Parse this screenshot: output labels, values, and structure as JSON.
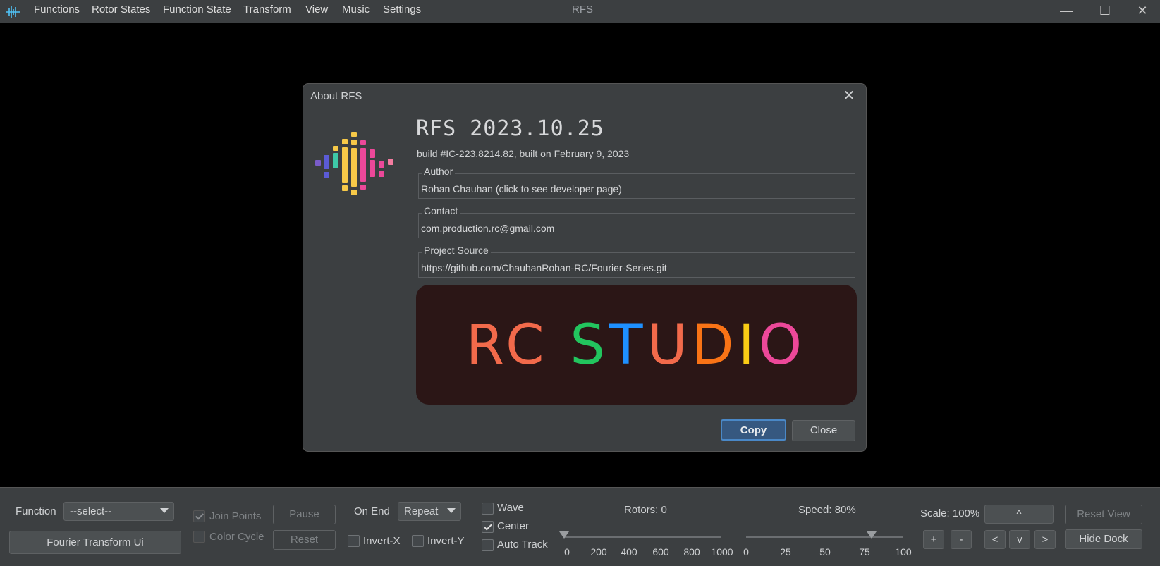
{
  "titlebar": {
    "window_title": "RFS",
    "menu": [
      "Functions",
      "Rotor States",
      "Function State",
      "Transform",
      "View",
      "Music",
      "Settings"
    ],
    "controls": {
      "minimize": "—",
      "maximize": "☐",
      "close": "✕"
    }
  },
  "dialog": {
    "title": "About RFS",
    "close_glyph": "✕",
    "app_name": "RFS 2023.10.25",
    "build_info": "build #IC-223.8214.82, built on February 9, 2023",
    "fields": [
      {
        "legend": "Author",
        "value": "Rohan Chauhan (click to see developer page)"
      },
      {
        "legend": "Contact",
        "value": "com.production.rc@gmail.com"
      },
      {
        "legend": "Project Source",
        "value": "https://github.com/ChauhanRohan-RC/Fourier-Series.git"
      }
    ],
    "banner_text": "RC STUDIO",
    "copy_label": "Copy",
    "close_label": "Close"
  },
  "dock": {
    "function_label": "Function",
    "function_select": "--select--",
    "fourier_button": "Fourier Transform Ui",
    "join_points": {
      "label": "Join Points",
      "checked": true,
      "enabled": false
    },
    "color_cycle": {
      "label": "Color Cycle",
      "checked": false,
      "enabled": false
    },
    "pause_button": "Pause",
    "reset_button": "Reset",
    "on_end_label": "On End",
    "on_end_select": "Repeat",
    "invert_x": {
      "label": "Invert-X",
      "checked": false
    },
    "invert_y": {
      "label": "Invert-Y",
      "checked": false
    },
    "wave": {
      "label": "Wave",
      "checked": false
    },
    "center": {
      "label": "Center",
      "checked": true
    },
    "auto_track": {
      "label": "Auto Track",
      "checked": false
    },
    "rotors_label": "Rotors: 0",
    "rotors_value": 0,
    "rotors_ticks": [
      "0",
      "200",
      "400",
      "600",
      "800",
      "1000"
    ],
    "speed_label": "Speed: 80%",
    "speed_value": 80,
    "speed_ticks": [
      "0",
      "25",
      "50",
      "75",
      "100"
    ],
    "scale_label": "Scale: 100%",
    "pan_up": "^",
    "pan_left": "<",
    "pan_down": "v",
    "pan_right": ">",
    "zoom_in": "+",
    "zoom_out": "-",
    "reset_view_button": "Reset View",
    "hide_dock_button": "Hide Dock"
  },
  "colors": {
    "accent": "#4a88c7",
    "background": "#3c3f41",
    "banner_bg": "#2b1616",
    "banner_letters": [
      "#f26a4b",
      "#f26a4b",
      "#22c55e",
      "#1e90ff",
      "#f26a4b",
      "#f97316",
      "#facc15",
      "#ec4899",
      "#ec4899"
    ]
  }
}
